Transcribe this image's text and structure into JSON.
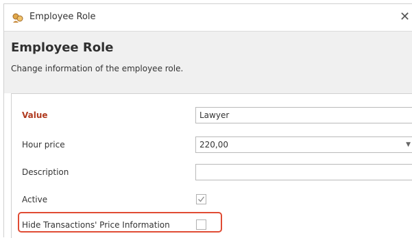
{
  "window": {
    "title": "Employee Role",
    "icon": "employee-role-icon",
    "close_glyph": "✕"
  },
  "header": {
    "title": "Employee Role",
    "subtitle": "Change information of the employee role."
  },
  "form": {
    "value": {
      "label": "Value",
      "value": "Lawyer"
    },
    "hour_price": {
      "label": "Hour price",
      "value": "220,00"
    },
    "description": {
      "label": "Description",
      "value": ""
    },
    "active": {
      "label": "Active",
      "checked": true
    },
    "hide_price": {
      "label": "Hide Transactions' Price Information",
      "checked": false
    }
  },
  "colors": {
    "required_label": "#b03a1f",
    "highlight_border": "#e04b33"
  }
}
